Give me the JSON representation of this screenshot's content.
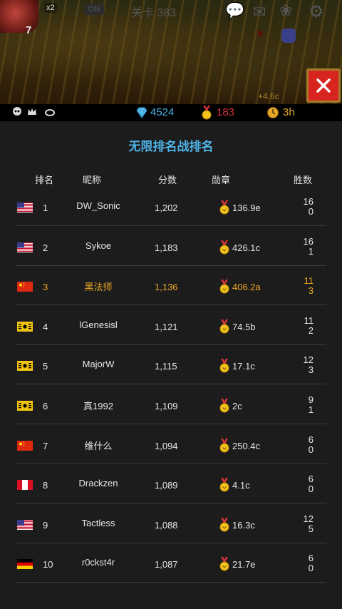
{
  "topbar": {
    "level": "7",
    "x2_label": "x2",
    "toggle_label": "ON",
    "stage_title": "关卡 383",
    "rate_text": "+4.6c"
  },
  "currency": {
    "gems": "4524",
    "medals": "183",
    "time": "3h"
  },
  "ranking": {
    "title": "无限排名战排名",
    "headers": {
      "rank": "排名",
      "name": "昵称",
      "score": "分数",
      "medal": "勋章",
      "wins": "胜数"
    },
    "rows": [
      {
        "flag": "us",
        "rank": "1",
        "name": "DW_Sonic",
        "score": "1,202",
        "medal": "136.9e",
        "wins_top": "16",
        "wins_bottom": "0",
        "highlight": false
      },
      {
        "flag": "us",
        "rank": "2",
        "name": "Sykoe",
        "score": "1,183",
        "medal": "426.1c",
        "wins_top": "16",
        "wins_bottom": "1",
        "highlight": false
      },
      {
        "flag": "cn",
        "rank": "3",
        "name": "黑法师",
        "score": "1,136",
        "medal": "406.2a",
        "wins_top": "11",
        "wins_bottom": "3",
        "highlight": true
      },
      {
        "flag": "kr",
        "rank": "4",
        "name": "lGenesisl",
        "score": "1,121",
        "medal": "74.5b",
        "wins_top": "11",
        "wins_bottom": "2",
        "highlight": false
      },
      {
        "flag": "kr",
        "rank": "5",
        "name": "MajorW",
        "score": "1,115",
        "medal": "17.1c",
        "wins_top": "12",
        "wins_bottom": "3",
        "highlight": false
      },
      {
        "flag": "kr",
        "rank": "6",
        "name": "真1992",
        "score": "1,109",
        "medal": "2c",
        "wins_top": "9",
        "wins_bottom": "1",
        "highlight": false
      },
      {
        "flag": "cn",
        "rank": "7",
        "name": "维什么",
        "score": "1,094",
        "medal": "250.4c",
        "wins_top": "6",
        "wins_bottom": "0",
        "highlight": false
      },
      {
        "flag": "pe",
        "rank": "8",
        "name": "Drackzen",
        "score": "1,089",
        "medal": "4.1c",
        "wins_top": "6",
        "wins_bottom": "0",
        "highlight": false
      },
      {
        "flag": "us",
        "rank": "9",
        "name": "Tactless",
        "score": "1,088",
        "medal": "16.3c",
        "wins_top": "12",
        "wins_bottom": "5",
        "highlight": false
      },
      {
        "flag": "de",
        "rank": "10",
        "name": "r0ckst4r",
        "score": "1,087",
        "medal": "21.7e",
        "wins_top": "6",
        "wins_bottom": "0",
        "highlight": false
      }
    ]
  },
  "colors": {
    "accent_blue": "#4fb3e8",
    "highlight_orange": "#f0a723",
    "close_red": "#d8241e"
  }
}
